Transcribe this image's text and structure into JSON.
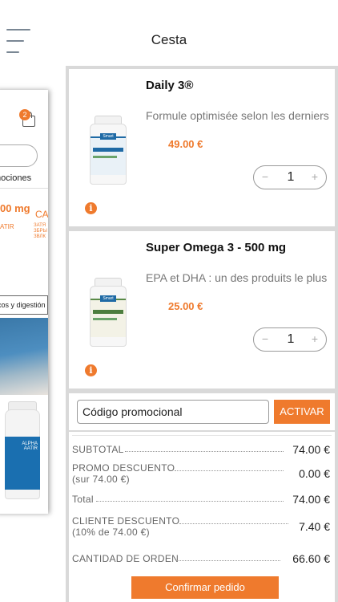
{
  "header": {
    "title": "Cesta",
    "menu_icon": "hamburger-menu-icon"
  },
  "background_app": {
    "cart_badge": "2",
    "promo_tab_fragment": "mociones",
    "price_fragment": "00 mg",
    "car_fragment": "CAR",
    "atir_fragment": "ATIR",
    "menu_fragment": "cos y digestión"
  },
  "cart": {
    "items": [
      {
        "name": "Daily 3®",
        "description": "Formule optimisée selon les derniers",
        "price": "49.00 €",
        "quantity": "1",
        "minus": "−",
        "plus": "+"
      },
      {
        "name": "Super Omega 3 - 500 mg",
        "description": "EPA et DHA : un des produits le plus",
        "price": "25.00 €",
        "quantity": "1",
        "minus": "−",
        "plus": "+"
      }
    ]
  },
  "promo": {
    "placeholder": "Código promocional",
    "button": "ACTIVAR"
  },
  "summary": {
    "subtotal_label": "SUBTOTAL",
    "subtotal_value": "74.00 €",
    "promo_label_1": "PROMO DESCUENTO",
    "promo_label_2": "(sur 74.00 €)",
    "promo_value": "0.00 €",
    "total_label": "Total",
    "total_value": "74.00 €",
    "client_label_1": "CLIENTE DESCUENTO",
    "client_label_2": "(10% de 74.00 €)",
    "client_value": "7.40 €",
    "order_label": "CANTIDAD DE ORDEN",
    "order_value": "66.60 €"
  },
  "confirm_button": "Confirmar pedido",
  "colors": {
    "accent": "#ef7a2d",
    "panel_bg": "#d9d9d9"
  }
}
